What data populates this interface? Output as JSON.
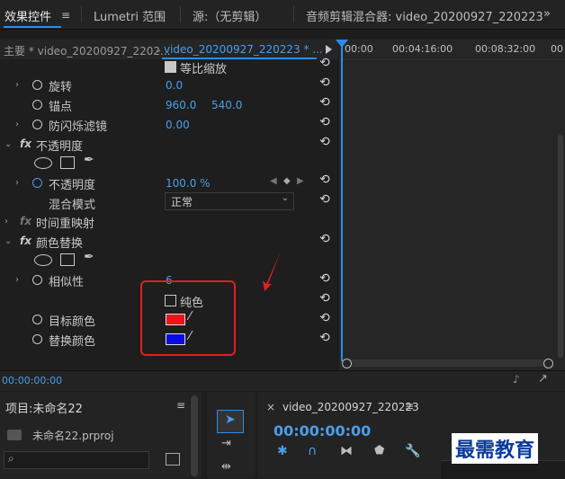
{
  "tabs": {
    "effect_controls": "效果控件",
    "lumetri": "Lumetri 范围",
    "source": "源:（无剪辑）",
    "audio_mixer": "音频剪辑混合器: video_20200927_220223"
  },
  "sequence": {
    "master": "主要 * video_20200927_2202...",
    "name": "video_20200927_220223 * ...",
    "ruler": [
      "00:00",
      "00:04:16:00",
      "00:08:32:00",
      "00"
    ]
  },
  "properties": {
    "uniform_scale": "等比缩放",
    "rotation": {
      "label": "旋转",
      "value": "0.0"
    },
    "anchor": {
      "label": "锚点",
      "x": "960.0",
      "y": "540.0"
    },
    "anti_flicker": {
      "label": "防闪烁滤镜",
      "value": "0.00"
    },
    "opacity_section": "不透明度",
    "opacity": {
      "label": "不透明度",
      "value": "100.0 %"
    },
    "blend_mode": {
      "label": "混合模式",
      "value": "正常"
    },
    "time_remap": "时间重映射",
    "color_replace": "颜色替换",
    "similarity": {
      "label": "相似性",
      "value": "6"
    },
    "solid_color": "纯色",
    "target_color": {
      "label": "目标颜色",
      "color": "#e8161b"
    },
    "replace_color": {
      "label": "替换颜色",
      "color": "#0a0ae6"
    }
  },
  "status": {
    "timecode": "00:00:00:00"
  },
  "project": {
    "title": "项目:未命名22",
    "file": "未命名22.prproj"
  },
  "timeline": {
    "title": "video_20200927_220223",
    "timecode": "00:00:00:00"
  },
  "watermark": "最需教育",
  "colors": {
    "accent": "#2d8ceb",
    "highlight_box": "#e02020"
  }
}
